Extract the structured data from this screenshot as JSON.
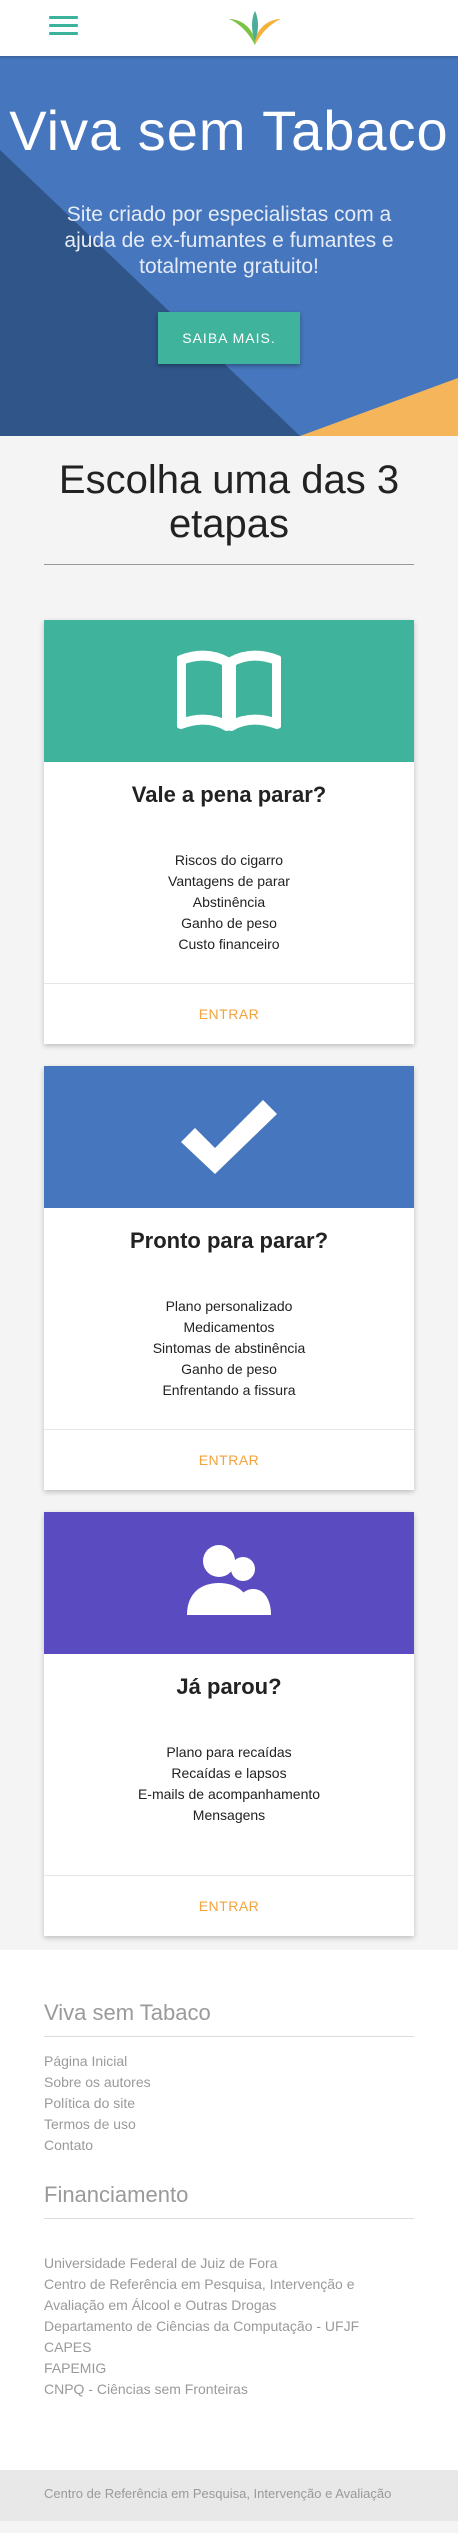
{
  "navbar": {
    "menu_icon": "hamburger-menu-icon",
    "logo_icon": "leaf-logo-icon"
  },
  "hero": {
    "title": "Viva sem Tabaco",
    "subtitle": "Site criado por especialistas com a ajuda de ex-fumantes e fumantes e totalmente gratuito!",
    "button_label": "SAIBA MAIS.",
    "colors": {
      "primary": "#4676bd",
      "dark": "#2f5589",
      "accent": "#f5b55a",
      "button": "#3fb39b"
    }
  },
  "steps": {
    "title": "Escolha uma das 3 etapas",
    "cards": [
      {
        "title": "Vale a pena parar?",
        "icon": "open-book-icon",
        "color": "#3fb39b",
        "items": [
          "Riscos do cigarro",
          "Vantagens de parar",
          "Abstinência",
          "Ganho de peso",
          "Custo financeiro"
        ],
        "action": "ENTRAR"
      },
      {
        "title": "Pronto para parar?",
        "icon": "checkmark-icon",
        "color": "#4676bd",
        "items": [
          "Plano personalizado",
          "Medicamentos",
          "Sintomas de abstinência",
          "Ganho de peso",
          "Enfrentando a fissura"
        ],
        "action": "ENTRAR"
      },
      {
        "title": "Já parou?",
        "icon": "users-icon",
        "color": "#5b4bc0",
        "items": [
          "Plano para recaídas",
          "Recaídas e lapsos",
          "E-mails de acompanhamento",
          "Mensagens"
        ],
        "action": "ENTRAR"
      }
    ]
  },
  "footer": {
    "site_heading": "Viva sem Tabaco",
    "site_links": [
      "Página Inicial",
      "Sobre os autores",
      "Política do site",
      "Termos de uso",
      "Contato"
    ],
    "funding_heading": "Financiamento",
    "funding_links": [
      "Universidade Federal de Juiz de Fora",
      "Centro de Referência em Pesquisa, Intervenção e Avaliação em Álcool e Outras Drogas",
      "Departamento de Ciências da Computação - UFJF",
      "CAPES",
      "FAPEMIG",
      "CNPQ - Ciências sem Fronteiras"
    ],
    "bottom_text": "Centro de Referência em Pesquisa, Intervenção e Avaliação"
  }
}
